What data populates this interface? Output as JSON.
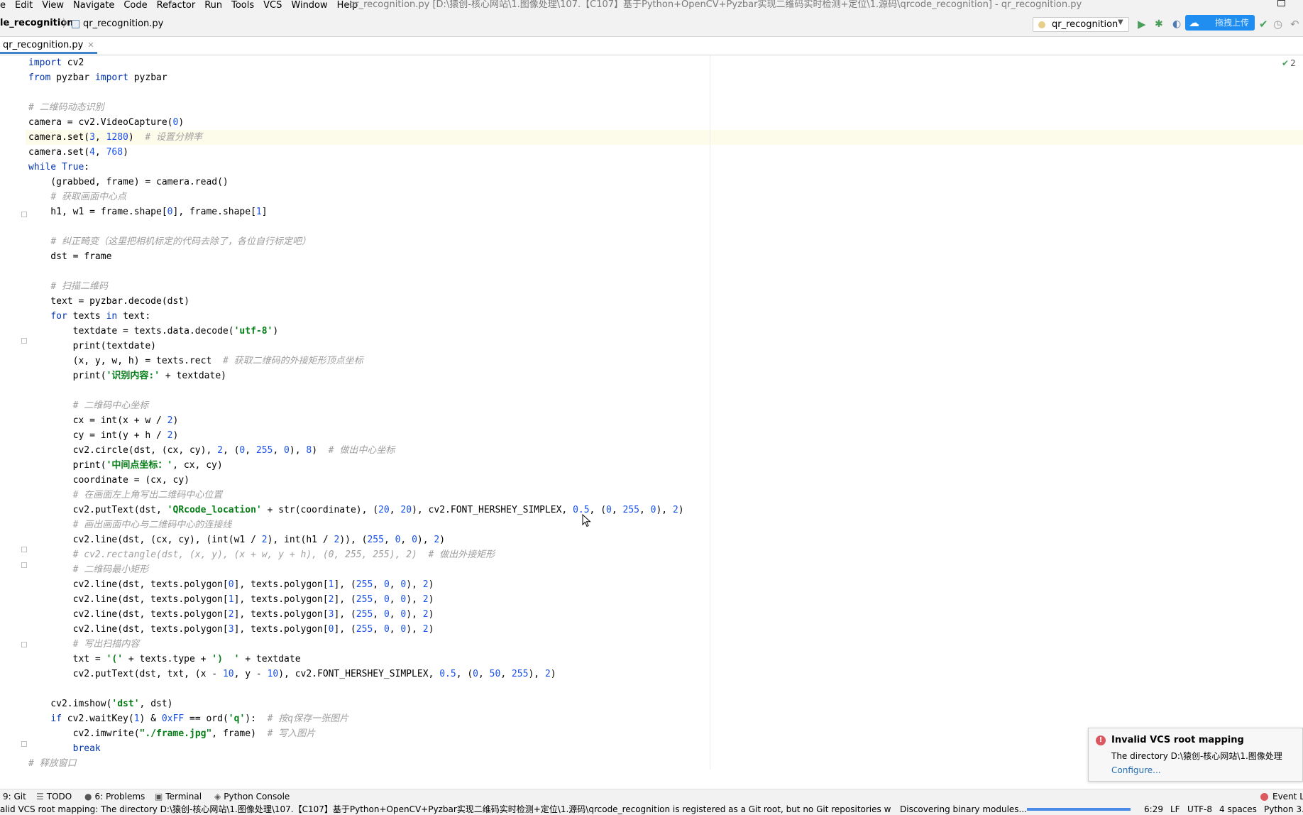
{
  "menubar": {
    "items": [
      "e",
      "Edit",
      "View",
      "Navigate",
      "Code",
      "Refactor",
      "Run",
      "Tools",
      "VCS",
      "Window",
      "Help"
    ]
  },
  "window": {
    "title": "qr_recognition.py [D:\\猿创-核心网站\\1.图像处理\\107.【C107】基于Python+OpenCV+Pyzbar实现二维码实时检测+定位\\1.源码\\qrcode_recognition] - qr_recognition.py"
  },
  "navbar": {
    "project": "le_recognition",
    "file": "qr_recognition.py",
    "run_config": "qr_recognition",
    "cloud_upload_label": "拖拽上传"
  },
  "tab": {
    "label": "qr_recognition.py"
  },
  "editor": {
    "inspection_count": "2",
    "code_lines": [
      [
        [
          "kw",
          "import"
        ],
        [
          "p",
          " cv2"
        ]
      ],
      [
        [
          "kw",
          "from"
        ],
        [
          "p",
          " pyzbar "
        ],
        [
          "kw",
          "import"
        ],
        [
          "p",
          " pyzbar"
        ]
      ],
      [],
      [
        [
          "cmt",
          "# 二维码动态识别"
        ]
      ],
      [
        [
          "p",
          "camera = cv2.VideoCapture("
        ],
        [
          "num",
          "0"
        ],
        [
          "p",
          ")"
        ]
      ],
      [
        [
          "p",
          "camera.set("
        ],
        [
          "num",
          "3"
        ],
        [
          "p",
          ", "
        ],
        [
          "num",
          "1280"
        ],
        [
          "p",
          ")  "
        ],
        [
          "cmt",
          "# 设置分辨率"
        ]
      ],
      [
        [
          "p",
          "camera.set("
        ],
        [
          "num",
          "4"
        ],
        [
          "p",
          ", "
        ],
        [
          "num",
          "768"
        ],
        [
          "p",
          ")"
        ]
      ],
      [
        [
          "kw",
          "while"
        ],
        [
          "p",
          " "
        ],
        [
          "kw",
          "True"
        ],
        [
          "p",
          ":"
        ]
      ],
      [
        [
          "p",
          "    (grabbed, frame) = camera.read()"
        ]
      ],
      [
        [
          "p",
          "    "
        ],
        [
          "cmt",
          "# 获取画面中心点"
        ]
      ],
      [
        [
          "p",
          "    h1, w1 = frame.shape["
        ],
        [
          "num",
          "0"
        ],
        [
          "p",
          "], frame.shape["
        ],
        [
          "num",
          "1"
        ],
        [
          "p",
          "]"
        ]
      ],
      [],
      [
        [
          "p",
          "    "
        ],
        [
          "cmt",
          "# 纠正畸变（这里把相机标定的代码去除了，各位自行标定吧）"
        ]
      ],
      [
        [
          "p",
          "    dst = frame"
        ]
      ],
      [],
      [
        [
          "p",
          "    "
        ],
        [
          "cmt",
          "# 扫描二维码"
        ]
      ],
      [
        [
          "p",
          "    text = pyzbar.decode(dst)"
        ]
      ],
      [
        [
          "p",
          "    "
        ],
        [
          "kw",
          "for"
        ],
        [
          "p",
          " texts "
        ],
        [
          "kw",
          "in"
        ],
        [
          "p",
          " text:"
        ]
      ],
      [
        [
          "p",
          "        textdate = texts.data.decode("
        ],
        [
          "str",
          "'utf-8'"
        ],
        [
          "p",
          ")"
        ]
      ],
      [
        [
          "p",
          "        print(textdate)"
        ]
      ],
      [
        [
          "p",
          "        (x, y, w, h) = texts.rect  "
        ],
        [
          "cmt",
          "# 获取二维码的外接矩形顶点坐标"
        ]
      ],
      [
        [
          "p",
          "        print("
        ],
        [
          "str",
          "'识别内容:'"
        ],
        [
          "p",
          " + textdate)"
        ]
      ],
      [],
      [
        [
          "p",
          "        "
        ],
        [
          "cmt",
          "# 二维码中心坐标"
        ]
      ],
      [
        [
          "p",
          "        cx = int(x + w / "
        ],
        [
          "num",
          "2"
        ],
        [
          "p",
          ")"
        ]
      ],
      [
        [
          "p",
          "        cy = int(y + h / "
        ],
        [
          "num",
          "2"
        ],
        [
          "p",
          ")"
        ]
      ],
      [
        [
          "p",
          "        cv2.circle(dst, (cx, cy), "
        ],
        [
          "num",
          "2"
        ],
        [
          "p",
          ", ("
        ],
        [
          "num",
          "0"
        ],
        [
          "p",
          ", "
        ],
        [
          "num",
          "255"
        ],
        [
          "p",
          ", "
        ],
        [
          "num",
          "0"
        ],
        [
          "p",
          "), "
        ],
        [
          "num",
          "8"
        ],
        [
          "p",
          ")  "
        ],
        [
          "cmt",
          "# 做出中心坐标"
        ]
      ],
      [
        [
          "p",
          "        print("
        ],
        [
          "str",
          "'中间点坐标：'"
        ],
        [
          "p",
          ", cx, cy)"
        ]
      ],
      [
        [
          "p",
          "        coordinate = (cx, cy)"
        ]
      ],
      [
        [
          "p",
          "        "
        ],
        [
          "cmt",
          "# 在画面左上角写出二维码中心位置"
        ]
      ],
      [
        [
          "p",
          "        cv2.putText(dst, "
        ],
        [
          "str",
          "'QRcode_location'"
        ],
        [
          "p",
          " + str(coordinate), ("
        ],
        [
          "num",
          "20"
        ],
        [
          "p",
          ", "
        ],
        [
          "num",
          "20"
        ],
        [
          "p",
          "), cv2.FONT_HERSHEY_SIMPLEX, "
        ],
        [
          "num",
          "0.5"
        ],
        [
          "p",
          ", ("
        ],
        [
          "num",
          "0"
        ],
        [
          "p",
          ", "
        ],
        [
          "num",
          "255"
        ],
        [
          "p",
          ", "
        ],
        [
          "num",
          "0"
        ],
        [
          "p",
          "), "
        ],
        [
          "num",
          "2"
        ],
        [
          "p",
          ")"
        ]
      ],
      [
        [
          "p",
          "        "
        ],
        [
          "cmt",
          "# 画出画面中心与二维码中心的连接线"
        ]
      ],
      [
        [
          "p",
          "        cv2.line(dst, (cx, cy), (int(w1 / "
        ],
        [
          "num",
          "2"
        ],
        [
          "p",
          "), int(h1 / "
        ],
        [
          "num",
          "2"
        ],
        [
          "p",
          ")), ("
        ],
        [
          "num",
          "255"
        ],
        [
          "p",
          ", "
        ],
        [
          "num",
          "0"
        ],
        [
          "p",
          ", "
        ],
        [
          "num",
          "0"
        ],
        [
          "p",
          "), "
        ],
        [
          "num",
          "2"
        ],
        [
          "p",
          ")"
        ]
      ],
      [
        [
          "p",
          "        "
        ],
        [
          "cmt",
          "# cv2.rectangle(dst, (x, y), (x + w, y + h), (0, 255, 255), 2)  # 做出外接矩形"
        ]
      ],
      [
        [
          "p",
          "        "
        ],
        [
          "cmt",
          "# 二维码最小矩形"
        ]
      ],
      [
        [
          "p",
          "        cv2.line(dst, texts.polygon["
        ],
        [
          "num",
          "0"
        ],
        [
          "p",
          "], texts.polygon["
        ],
        [
          "num",
          "1"
        ],
        [
          "p",
          "], ("
        ],
        [
          "num",
          "255"
        ],
        [
          "p",
          ", "
        ],
        [
          "num",
          "0"
        ],
        [
          "p",
          ", "
        ],
        [
          "num",
          "0"
        ],
        [
          "p",
          "), "
        ],
        [
          "num",
          "2"
        ],
        [
          "p",
          ")"
        ]
      ],
      [
        [
          "p",
          "        cv2.line(dst, texts.polygon["
        ],
        [
          "num",
          "1"
        ],
        [
          "p",
          "], texts.polygon["
        ],
        [
          "num",
          "2"
        ],
        [
          "p",
          "], ("
        ],
        [
          "num",
          "255"
        ],
        [
          "p",
          ", "
        ],
        [
          "num",
          "0"
        ],
        [
          "p",
          ", "
        ],
        [
          "num",
          "0"
        ],
        [
          "p",
          "), "
        ],
        [
          "num",
          "2"
        ],
        [
          "p",
          ")"
        ]
      ],
      [
        [
          "p",
          "        cv2.line(dst, texts.polygon["
        ],
        [
          "num",
          "2"
        ],
        [
          "p",
          "], texts.polygon["
        ],
        [
          "num",
          "3"
        ],
        [
          "p",
          "], ("
        ],
        [
          "num",
          "255"
        ],
        [
          "p",
          ", "
        ],
        [
          "num",
          "0"
        ],
        [
          "p",
          ", "
        ],
        [
          "num",
          "0"
        ],
        [
          "p",
          "), "
        ],
        [
          "num",
          "2"
        ],
        [
          "p",
          ")"
        ]
      ],
      [
        [
          "p",
          "        cv2.line(dst, texts.polygon["
        ],
        [
          "num",
          "3"
        ],
        [
          "p",
          "], texts.polygon["
        ],
        [
          "num",
          "0"
        ],
        [
          "p",
          "], ("
        ],
        [
          "num",
          "255"
        ],
        [
          "p",
          ", "
        ],
        [
          "num",
          "0"
        ],
        [
          "p",
          ", "
        ],
        [
          "num",
          "0"
        ],
        [
          "p",
          "), "
        ],
        [
          "num",
          "2"
        ],
        [
          "p",
          ")"
        ]
      ],
      [
        [
          "p",
          "        "
        ],
        [
          "cmt",
          "# 写出扫描内容"
        ]
      ],
      [
        [
          "p",
          "        txt = "
        ],
        [
          "str",
          "'('"
        ],
        [
          "p",
          " + texts.type + "
        ],
        [
          "str",
          "')  '"
        ],
        [
          "p",
          " + textdate"
        ]
      ],
      [
        [
          "p",
          "        cv2.putText(dst, txt, (x - "
        ],
        [
          "num",
          "10"
        ],
        [
          "p",
          ", y - "
        ],
        [
          "num",
          "10"
        ],
        [
          "p",
          "), cv2.FONT_HERSHEY_SIMPLEX, "
        ],
        [
          "num",
          "0.5"
        ],
        [
          "p",
          ", ("
        ],
        [
          "num",
          "0"
        ],
        [
          "p",
          ", "
        ],
        [
          "num",
          "50"
        ],
        [
          "p",
          ", "
        ],
        [
          "num",
          "255"
        ],
        [
          "p",
          "), "
        ],
        [
          "num",
          "2"
        ],
        [
          "p",
          ")"
        ]
      ],
      [],
      [
        [
          "p",
          "    cv2.imshow("
        ],
        [
          "str",
          "'dst'"
        ],
        [
          "p",
          ", dst)"
        ]
      ],
      [
        [
          "p",
          "    "
        ],
        [
          "kw",
          "if"
        ],
        [
          "p",
          " cv2.waitKey("
        ],
        [
          "num",
          "1"
        ],
        [
          "p",
          ") & "
        ],
        [
          "num",
          "0xFF"
        ],
        [
          "p",
          " == ord("
        ],
        [
          "str",
          "'q'"
        ],
        [
          "p",
          "):  "
        ],
        [
          "cmt",
          "# 按q保存一张图片"
        ]
      ],
      [
        [
          "p",
          "        cv2.imwrite("
        ],
        [
          "str",
          "\"./frame.jpg\""
        ],
        [
          "p",
          ", frame)  "
        ],
        [
          "cmt",
          "# 写入图片"
        ]
      ],
      [
        [
          "p",
          "        "
        ],
        [
          "kw",
          "break"
        ]
      ],
      [
        [
          "cmt",
          "# 释放窗口"
        ]
      ]
    ]
  },
  "notification": {
    "title": "Invalid VCS root mapping",
    "body": "The directory D:\\猿创-核心网站\\1.图像处理",
    "link": "Configure..."
  },
  "toolwindows": {
    "git": "9: Git",
    "todo": "TODO",
    "problems": "6: Problems",
    "terminal": "Terminal",
    "python_console": "Python Console",
    "event_log": "Event Lo"
  },
  "statusbar": {
    "message": "alid VCS root mapping: The directory D:\\猿创-核心网站\\1.图像处理\\107.【C107】基于Python+OpenCV+Pyzbar实现二维码实时检测+定位\\1.源码\\qrcode_recognition is registered as a Git root, but no Git repositories wer...",
    "background_task": "Discovering binary modules...",
    "progress": 1.0,
    "position": "6:29",
    "line_sep": "LF",
    "encoding": "UTF-8",
    "indent": "4 spaces",
    "interpreter": "Python 3."
  },
  "colors": {
    "keyword": "#0033b3",
    "number": "#1750eb",
    "string": "#067d17",
    "comment": "#9e9e9e",
    "accent": "#4083c9",
    "error": "#db5860",
    "run": "#4aa05a",
    "cloud": "#1f8ef0"
  }
}
